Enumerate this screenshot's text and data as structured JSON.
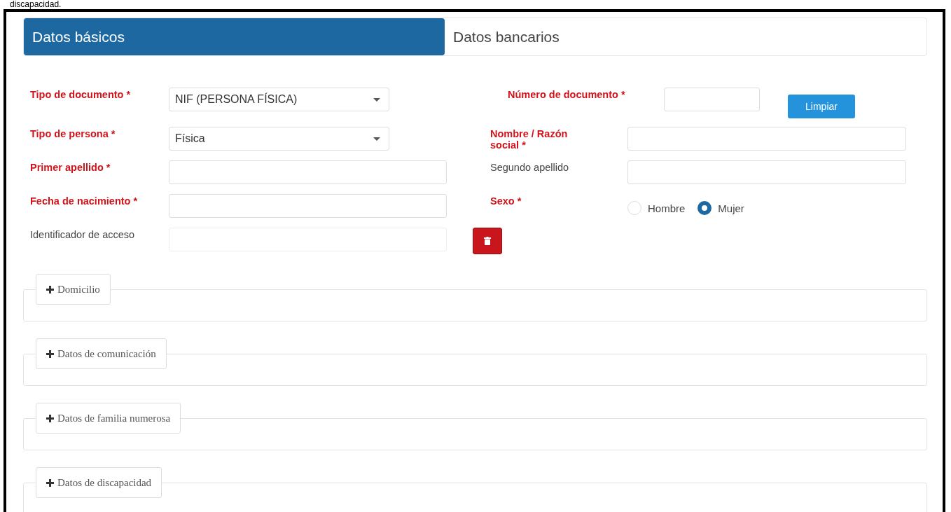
{
  "caption": "discapacidad.",
  "tabs": [
    {
      "label": "Datos básicos",
      "selected": true
    },
    {
      "label": "Datos bancarios",
      "selected": false
    }
  ],
  "rows": [
    {
      "left": {
        "kind": "select",
        "label": "Tipo de documento *",
        "required": true,
        "value": "NIF (PERSONA FÍSICA)"
      },
      "right": {
        "kind": "text_button",
        "label": "Número de documento *",
        "required": true,
        "button": "Limpiar"
      }
    },
    {
      "left": {
        "kind": "select",
        "label": "Tipo de persona *",
        "required": true,
        "value": "Física"
      },
      "right": {
        "kind": "text",
        "label": "Nombre / Razón social *",
        "required": true
      }
    },
    {
      "left": {
        "kind": "text",
        "label": "Primer apellido *",
        "required": true
      },
      "right": {
        "kind": "text",
        "label": "Segundo apellido",
        "required": false
      }
    },
    {
      "left": {
        "kind": "text",
        "label": "Fecha de nacimiento *",
        "required": true
      },
      "right": {
        "kind": "radio",
        "label": "Sexo *",
        "required": true,
        "options": [
          {
            "label": "Hombre",
            "selected": false
          },
          {
            "label": "Mujer",
            "selected": true
          }
        ]
      }
    },
    {
      "left": {
        "kind": "text_delete",
        "label": "Identificador de acceso",
        "required": false
      }
    }
  ],
  "sections": [
    {
      "label": "Domicilio",
      "expanded": false
    },
    {
      "label": "Datos de comunicación",
      "expanded": false
    },
    {
      "label": "Datos de familia numerosa",
      "expanded": false
    },
    {
      "label": "Datos de discapacidad",
      "expanded": false
    }
  ]
}
